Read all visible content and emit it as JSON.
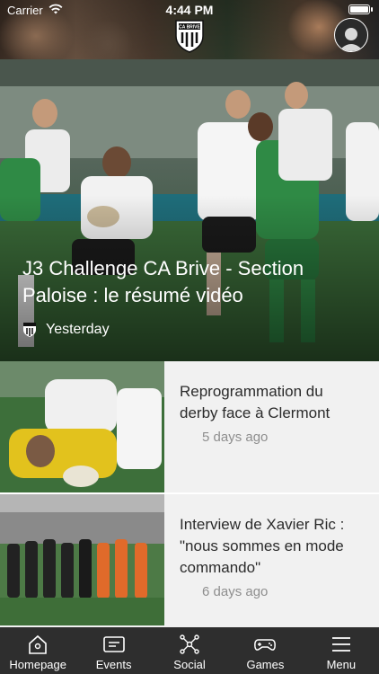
{
  "status_bar": {
    "carrier": "Carrier",
    "time": "4:44 PM"
  },
  "header": {
    "club_logo_text": "CA BRIVE",
    "logo_icon": "club-crest-icon",
    "profile_icon": "user-avatar-icon"
  },
  "hero": {
    "title": "J3 Challenge CA Brive - Section Paloise : le résumé vidéo",
    "date": "Yesterday"
  },
  "articles": [
    {
      "title": "Reprogrammation du derby face à Clermont",
      "date": "5 days ago"
    },
    {
      "title": "Interview de Xavier Ric : \"nous sommes en mode commando\"",
      "date": "6 days ago"
    }
  ],
  "tabbar": {
    "items": [
      {
        "label": "Homepage",
        "icon": "home-icon"
      },
      {
        "label": "Events",
        "icon": "events-icon"
      },
      {
        "label": "Social",
        "icon": "social-network-icon"
      },
      {
        "label": "Games",
        "icon": "gamepad-icon"
      },
      {
        "label": "Menu",
        "icon": "menu-icon"
      }
    ]
  },
  "colors": {
    "tabbar_bg": "#2e2e2e",
    "list_bg": "#f1f1f1",
    "title_text": "#2b2b2b",
    "date_text": "#8e8e8e"
  }
}
